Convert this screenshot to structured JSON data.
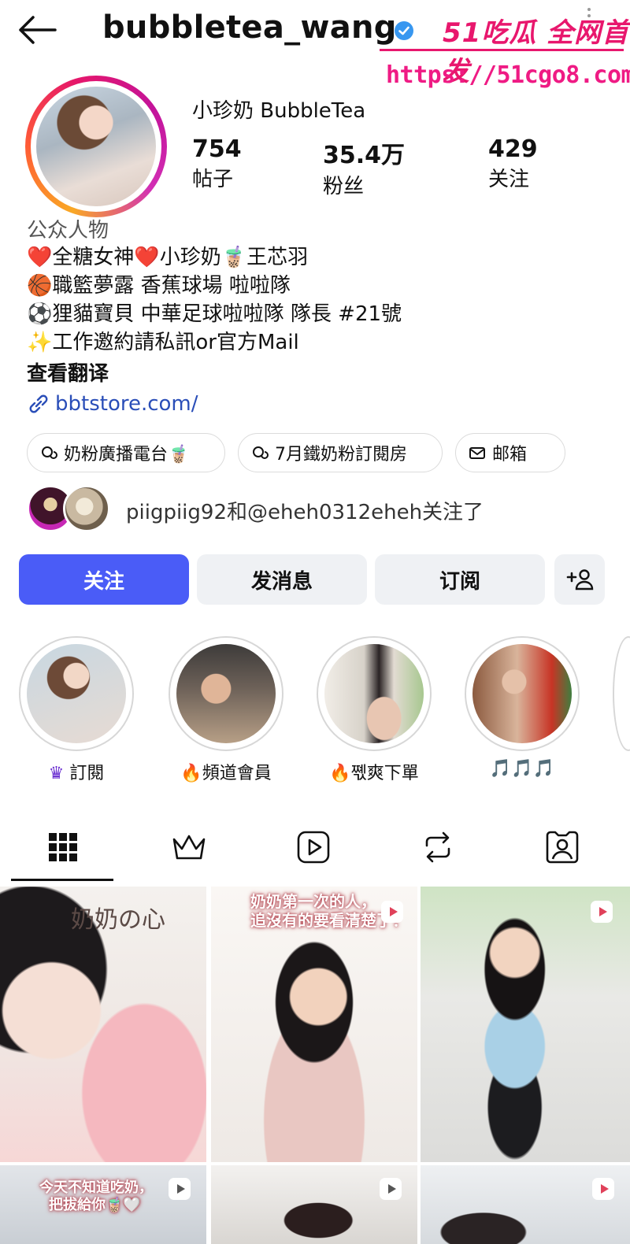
{
  "header": {
    "username": "bubbletea_wang",
    "watermark_top": "51吃瓜 全网首发",
    "watermark_url": "https://51cgo8.com"
  },
  "profile": {
    "display_name": "小珍奶 BubbleTea",
    "stats": [
      {
        "value": "754",
        "label": "帖子"
      },
      {
        "value": "35.4万",
        "label": "粉丝"
      },
      {
        "value": "429",
        "label": "关注"
      }
    ],
    "category": "公众人物",
    "bio": [
      "❤️全糖女神❤️小珍奶🧋王芯羽",
      "🏀職籃夢露 香蕉球場 啦啦隊",
      "⚽狸貓寶貝 中華足球啦啦隊 隊長 #21號",
      "✨工作邀約請私訊or官方Mail"
    ],
    "translate": "查看翻译",
    "link": "bbtstore.com/",
    "pills": [
      "奶粉廣播電台🧋",
      "7月鐵奶粉訂閱房",
      "邮箱"
    ],
    "followed_by": "piigpiig92和@eheh0312eheh关注了"
  },
  "actions": {
    "follow": "关注",
    "message": "发消息",
    "subscribe": "订阅"
  },
  "highlights": [
    {
      "label": "訂閱",
      "icon": "crown-icon"
    },
    {
      "label": "🔥頻道會員",
      "icon": ""
    },
    {
      "label": "🔥쪣爽下單",
      "icon": ""
    },
    {
      "label": "🎵🎵🎵",
      "icon": ""
    }
  ],
  "grid": {
    "overlay_1": "奶奶の心",
    "overlay_2a": "奶奶第一次的人，",
    "overlay_2b": "追沒有的要看清楚了！",
    "overlay_3a": "今天不知道吃奶，",
    "overlay_3b": "把拔給你🧋🤍"
  },
  "colors": {
    "accent": "#4a5cf7",
    "link": "#2a4eb8",
    "watermark": "#e8176d"
  }
}
